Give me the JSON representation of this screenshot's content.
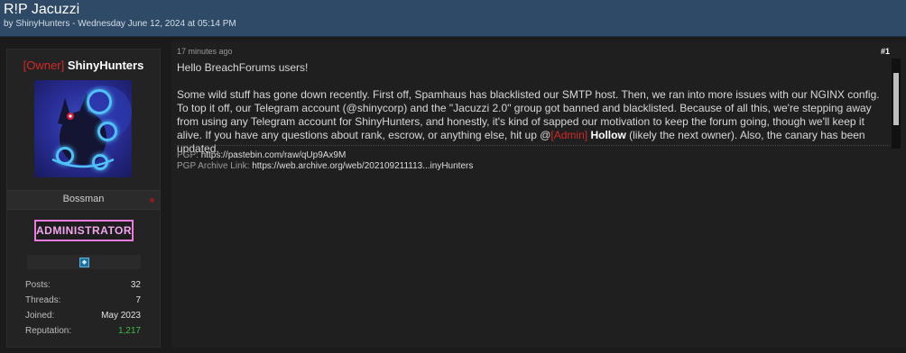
{
  "thread": {
    "title": "R!P Jacuzzi",
    "meta": "by ShinyHunters - Wednesday June 12, 2024 at 05:14 PM"
  },
  "user": {
    "role_tag": "[Owner]",
    "name": "ShinyHunters",
    "avatar": "umbreon-avatar",
    "title": "Bossman",
    "rank_badge": "ADMINISTRATOR",
    "stats": [
      {
        "label": "Posts:",
        "value": "32"
      },
      {
        "label": "Threads:",
        "value": "7"
      },
      {
        "label": "Joined:",
        "value": "May 2023"
      },
      {
        "label": "Reputation:",
        "value": "1,217"
      }
    ],
    "reputation_color": "#3fbf3f"
  },
  "post": {
    "time": "17 minutes ago",
    "number": "#1",
    "greeting": "Hello BreachForums users!",
    "body_before_mention": "Some wild stuff has gone down recently. First off, Spamhaus has blacklisted our SMTP host. Then, we ran into more issues with our NGINX config. To top it off, our Telegram account (@shinycorp) and the \"Jacuzzi 2.0\" group got banned and blacklisted. Because of all this, we're stepping away from using any Telegram account for ShinyHunters, and honestly, it's kind of sapped our motivation to keep the forum going, though we'll keep it alive. If you have any questions about rank, escrow, or anything else, hit up @",
    "mention_tag": "[Admin]",
    "mention_name": "Hollow",
    "body_after_mention": " (likely the next owner). Also, the canary has been updated.",
    "signature": {
      "pgp_label": "PGP:",
      "pgp_link": "https://pastebin.com/raw/qUp9Ax9M",
      "archive_label": "PGP Archive Link:",
      "archive_link": "https://web.archive.org/web/202109211113...inyHunters"
    }
  },
  "colors": {
    "header_bg": "#2e4a66",
    "owner_tag": "#d12a2a",
    "rank_badge": "#e87bdc"
  }
}
